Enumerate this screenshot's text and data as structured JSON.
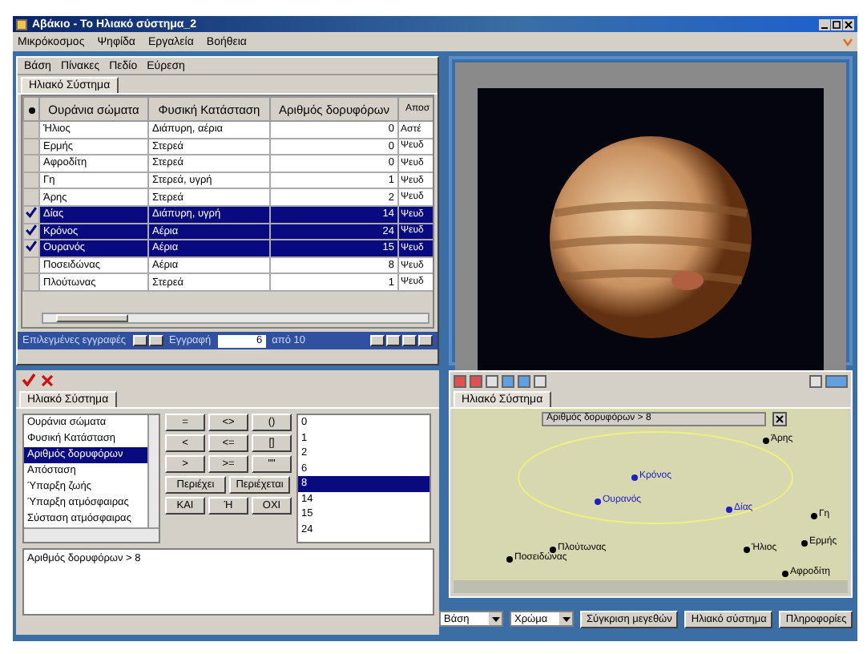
{
  "window": {
    "title": "Αβάκιο - Το Ηλιακό σύστημα_2"
  },
  "menu": [
    "Μικρόκοσμος",
    "Ψηφίδα",
    "Εργαλεία",
    "Βοήθεια"
  ],
  "grid_panel": {
    "menu": [
      "Βάση",
      "Πίνακες",
      "Πεδίο",
      "Εύρεση"
    ],
    "tab": "Ηλιακό Σύστημα",
    "columns": [
      "Ουράνια σώματα",
      "Φυσική Κατάσταση",
      "Αριθμός δορυφόρων",
      "Αποσ"
    ],
    "rows": [
      {
        "checked": false,
        "selected": false,
        "current": false,
        "cells": [
          "Ήλιος",
          "Διάπυρη, αέρια",
          "0",
          "Αστέ"
        ]
      },
      {
        "checked": false,
        "selected": false,
        "current": false,
        "cells": [
          "Ερμής",
          "Στερεά",
          "0",
          "Ψευδ"
        ]
      },
      {
        "checked": false,
        "selected": false,
        "current": false,
        "cells": [
          "Αφροδίτη",
          "Στερεά",
          "0",
          "Ψευδ"
        ]
      },
      {
        "checked": false,
        "selected": false,
        "current": false,
        "cells": [
          "Γη",
          "Στερεά, υγρή",
          "1",
          "Ψευδ"
        ]
      },
      {
        "checked": false,
        "selected": false,
        "current": false,
        "cells": [
          "Άρης",
          "Στερεά",
          "2",
          "Ψευδ"
        ]
      },
      {
        "checked": true,
        "selected": true,
        "current": true,
        "cells": [
          "Δίας",
          "Διάπυρη, υγρή",
          "14",
          "Ψευδ"
        ]
      },
      {
        "checked": true,
        "selected": true,
        "current": false,
        "cells": [
          "Κρόνος",
          "Αέρια",
          "24",
          "Ψευδ"
        ]
      },
      {
        "checked": true,
        "selected": true,
        "current": false,
        "cells": [
          "Ουρανός",
          "Αέρια",
          "15",
          "Ψευδ"
        ]
      },
      {
        "checked": false,
        "selected": false,
        "current": false,
        "cells": [
          "Ποσειδώνας",
          "Αέρια",
          "8",
          "Ψευδ"
        ]
      },
      {
        "checked": false,
        "selected": false,
        "current": false,
        "cells": [
          "Πλούτωνας",
          "Στερεά",
          "1",
          "Ψευδ"
        ]
      }
    ],
    "nav": {
      "label": "Επιλεγμένες εγγραφές",
      "record_label": "Εγγραφή",
      "record": "6",
      "of": "από 10"
    }
  },
  "query_panel": {
    "tab": "Ηλιακό Σύστημα",
    "fields": [
      {
        "label": "Ουράνια σώματα",
        "selected": false
      },
      {
        "label": "Φυσική Κατάσταση",
        "selected": false
      },
      {
        "label": "Αριθμός δορυφόρων",
        "selected": true
      },
      {
        "label": "Απόσταση",
        "selected": false
      },
      {
        "label": "Ύπαρξη ζωής",
        "selected": false
      },
      {
        "label": "Ύπαρξη ατμόσφαιρας",
        "selected": false
      },
      {
        "label": "Σύσταση ατμόσφαιρας",
        "selected": false
      }
    ],
    "operators": [
      "=",
      "<>",
      "()",
      "<",
      "<=",
      "[]",
      ">",
      ">=",
      "\"\"",
      "Περιέχει",
      "Περιέχεται",
      "ΚΑΙ",
      "Ή",
      "ΟΧΙ"
    ],
    "values": [
      {
        "label": "0",
        "selected": false
      },
      {
        "label": "1",
        "selected": false
      },
      {
        "label": "2",
        "selected": false
      },
      {
        "label": "6",
        "selected": false
      },
      {
        "label": "8",
        "selected": true
      },
      {
        "label": "14",
        "selected": false
      },
      {
        "label": "15",
        "selected": false
      },
      {
        "label": "24",
        "selected": false
      }
    ],
    "query": "Αριθμός δορυφόρων > 8"
  },
  "map_panel": {
    "tab": "Ηλιακό Σύστημα",
    "filter_label": "Αριθμός δορυφόρων > 8",
    "points": [
      {
        "label": "Άρης",
        "matched": false
      },
      {
        "label": "Κρόνος",
        "matched": true
      },
      {
        "label": "Ουρανός",
        "matched": true
      },
      {
        "label": "Δίας",
        "matched": true
      },
      {
        "label": "Γη",
        "matched": false
      },
      {
        "label": "Ερμής",
        "matched": false
      },
      {
        "label": "Πλούτωνας",
        "matched": false
      },
      {
        "label": "Ποσειδώνας",
        "matched": false
      },
      {
        "label": "Ήλιος",
        "matched": false
      },
      {
        "label": "Αφροδίτη",
        "matched": false
      }
    ]
  },
  "bottom": {
    "dropdowns": [
      "Βάση",
      "Χρώμα"
    ],
    "buttons": [
      "Σύγκριση μεγεθών",
      "Ηλιακό σύστημα",
      "Πληροφορίες"
    ]
  }
}
